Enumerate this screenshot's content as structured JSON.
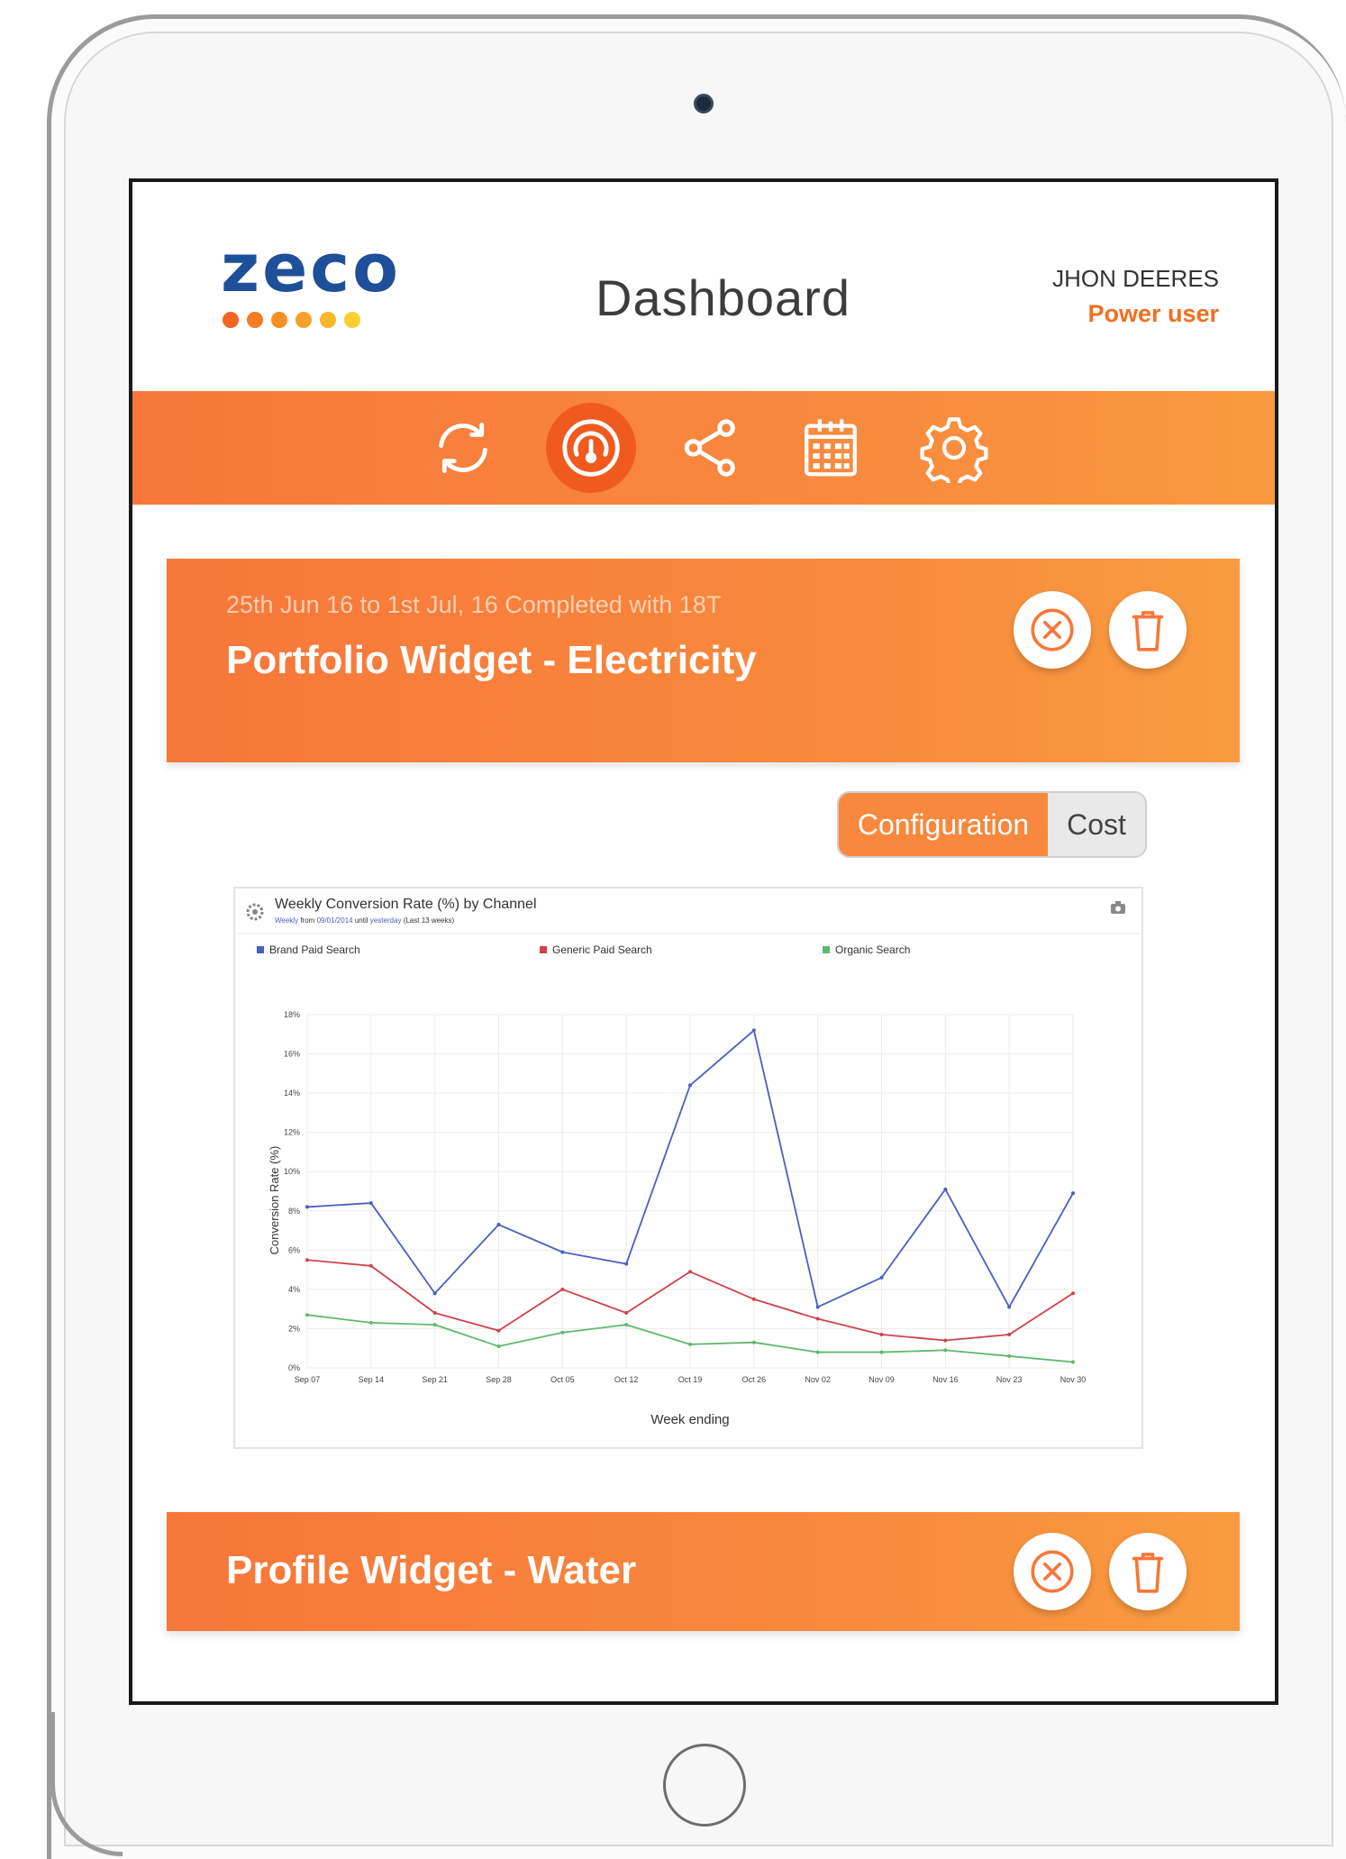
{
  "app": {
    "logo_text": "zeco",
    "logo_dot_colors": [
      "#f26522",
      "#f47a23",
      "#f58e25",
      "#f7a128",
      "#f9b72b",
      "#fbd030"
    ],
    "page_title": "Dashboard",
    "user": {
      "name": "JHON DEERES",
      "role": "Power user"
    },
    "accent_color": "#f8883d"
  },
  "toolbar": {
    "items": [
      {
        "icon": "refresh-icon",
        "active": false
      },
      {
        "icon": "dashboard-gauge-icon",
        "active": true
      },
      {
        "icon": "share-icon",
        "active": false
      },
      {
        "icon": "calendar-icon",
        "active": false
      },
      {
        "icon": "settings-gear-icon",
        "active": false
      }
    ]
  },
  "widgets": [
    {
      "subtitle": "25th Jun 16 to 1st Jul, 16 Completed with 18T",
      "title": "Portfolio Widget - Electricity",
      "actions": [
        "close-circle-icon",
        "trash-icon"
      ]
    },
    {
      "subtitle": "",
      "title": "Profile Widget - Water",
      "actions": [
        "close-circle-icon",
        "trash-icon"
      ]
    }
  ],
  "view_toggle": {
    "options": [
      "Configuration",
      "Cost"
    ],
    "selected": "Configuration"
  },
  "chart_data": {
    "type": "line",
    "title": "Weekly Conversion Rate (%) by Channel",
    "subtitle": {
      "period": "Weekly",
      "from_label": "from",
      "from_date": "09/01/2014",
      "until_label": "until",
      "until_value": "yesterday",
      "range_label": "(Last 13 weeks)"
    },
    "xlabel": "Week ending",
    "ylabel": "Conversion Rate (%)",
    "ylim": [
      0,
      18
    ],
    "y_ticks": [
      "0%",
      "2%",
      "4%",
      "6%",
      "8%",
      "10%",
      "12%",
      "14%",
      "16%",
      "18%"
    ],
    "categories": [
      "Sep 07",
      "Sep 14",
      "Sep 21",
      "Sep 28",
      "Oct 05",
      "Oct 12",
      "Oct 19",
      "Oct 26",
      "Nov 02",
      "Nov 09",
      "Nov 16",
      "Nov 23",
      "Nov 30"
    ],
    "legend_position": "top",
    "grid": true,
    "series": [
      {
        "name": "Brand Paid Search",
        "color": "#4a5fc1",
        "values": [
          8.2,
          8.4,
          3.8,
          7.3,
          5.9,
          5.3,
          14.4,
          17.2,
          3.1,
          4.6,
          9.1,
          3.1,
          8.9
        ]
      },
      {
        "name": "Generic Paid Search",
        "color": "#d0414b",
        "values": [
          5.5,
          5.2,
          2.8,
          1.9,
          4.0,
          2.8,
          4.9,
          3.5,
          2.5,
          1.7,
          1.4,
          1.7,
          3.8
        ]
      },
      {
        "name": "Organic Search",
        "color": "#5fb870",
        "values": [
          2.7,
          2.3,
          2.2,
          1.1,
          1.8,
          2.2,
          1.2,
          1.3,
          0.8,
          0.8,
          0.9,
          0.6,
          0.3
        ]
      }
    ]
  }
}
